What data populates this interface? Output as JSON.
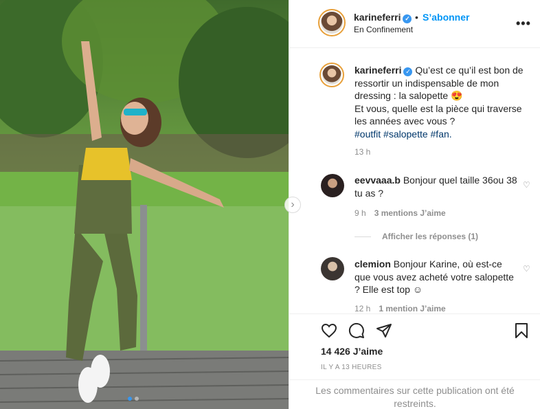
{
  "header": {
    "username": "karineferri",
    "follow_label": "S’abonner",
    "separator": "•",
    "location": "En Confinement",
    "more_label": "•••"
  },
  "caption": {
    "username": "karineferri",
    "text": "Qu’est ce qu’il est bon de ressortir un indispensable de mon dressing : la salopette 😍",
    "question": "Et vous, quelle est la pièce qui traverse les années avec vous ?",
    "hashtags": "#outfit #salopette #fan.",
    "time": "13 h"
  },
  "comments": [
    {
      "username": "eevvaaa.b",
      "text": "Bonjour quel taille 36ou 38 tu as ?",
      "time": "9 h",
      "likes": "3 mentions J’aime",
      "replies": "Afficher les réponses (1)"
    },
    {
      "username": "clemion",
      "text": "Bonjour Karine, où est-ce que vous avez acheté votre salopette ? Elle est top ☺",
      "time": "12 h",
      "likes": "1 mention J’aime"
    }
  ],
  "actions": {
    "likes": "14 426 J’aime",
    "timestamp": "IL Y A 13 HEURES",
    "restricted_line1": "Les commentaires sur cette publication ont été",
    "restricted_line2": "restreints."
  },
  "icons": {
    "like": "heart-icon",
    "comment": "comment-icon",
    "share": "paper-plane-icon",
    "save": "bookmark-icon",
    "verified": "verified-badge-icon",
    "next": "chevron-right-icon"
  },
  "carousel": {
    "slides": 2,
    "active": 1
  },
  "colors": {
    "accent": "#0095f6",
    "secondary": "#8e8e8e",
    "hashtag": "#00376b"
  }
}
